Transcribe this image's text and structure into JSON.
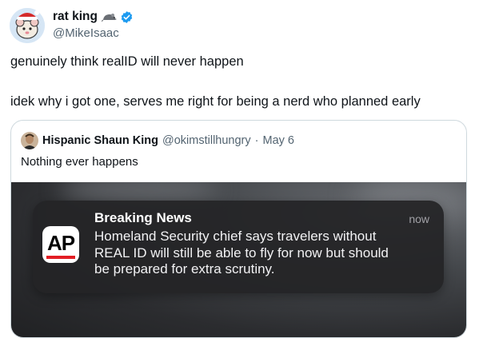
{
  "tweet": {
    "author": {
      "display_name": "rat king",
      "handle": "@MikeIsaac",
      "name_emoji_icon": "rat-icon",
      "verified": true
    },
    "text_lines": [
      "genuinely think realID will never happen",
      "idek why i got one, serves me right for being a nerd who planned early"
    ],
    "quote": {
      "author_name": "Hispanic Shaun King",
      "author_handle": "@okimstillhungry",
      "separator": "·",
      "date": "May 6",
      "text": "Nothing ever happens",
      "media": {
        "notification": {
          "app_logo_text": "AP",
          "title": "Breaking News",
          "time": "now",
          "body_lines": [
            "Homeland Security chief says travelers without",
            "REAL ID will still be able to fly for now but should",
            "be prepared for extra scrutiny."
          ]
        }
      }
    }
  },
  "colors": {
    "verified_blue": "#1d9bf0",
    "secondary_text": "#536471",
    "ap_red": "#e21d24"
  }
}
